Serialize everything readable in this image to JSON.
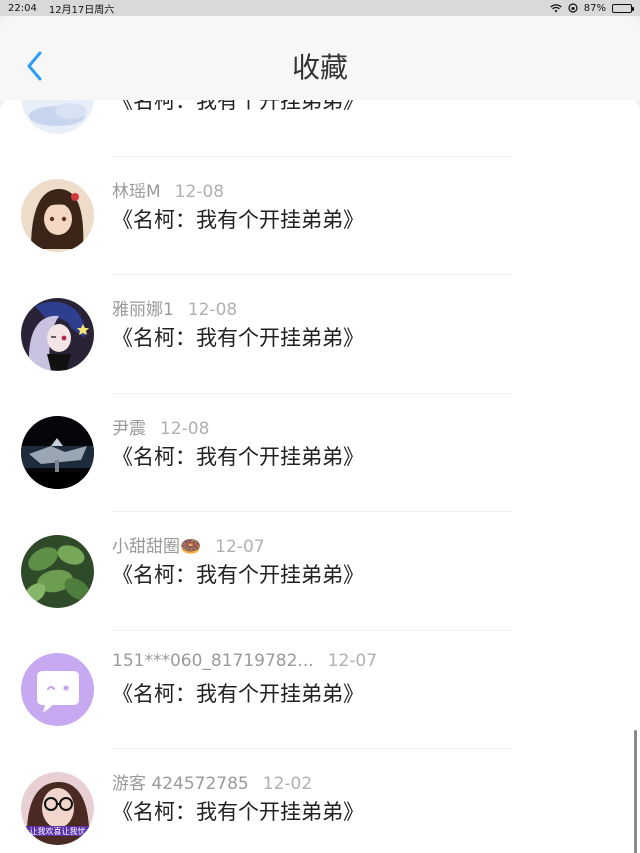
{
  "status": {
    "time": "22:04",
    "date": "12月17日周六",
    "battery": "87%",
    "battery_level": 0.87
  },
  "nav": {
    "title": "收藏"
  },
  "items": [
    {
      "name": "",
      "date": "",
      "title": "《名柯：我有个开挂弟弟》",
      "avatar": "cloud-avatar"
    },
    {
      "name": "林瑶M",
      "date": "12-08",
      "title": "《名柯：我有个开挂弟弟》",
      "avatar": "anime-girl-avatar"
    },
    {
      "name": "雅丽娜1",
      "date": "12-08",
      "title": "《名柯：我有个开挂弟弟》",
      "avatar": "purple-hair-avatar"
    },
    {
      "name": "尹震",
      "date": "12-08",
      "title": "《名柯：我有个开挂弟弟》",
      "avatar": "mecha-avatar"
    },
    {
      "name": "小甜甜圈🍩",
      "date": "12-07",
      "title": "《名柯：我有个开挂弟弟》",
      "avatar": "plant-avatar"
    },
    {
      "name": "151***060_81719782...",
      "date": "12-07",
      "title": "《名柯：我有个开挂弟弟》",
      "avatar": "chat-bubble-avatar"
    },
    {
      "name": "游客 424572785",
      "date": "12-02",
      "title": "《名柯：我有个开挂弟弟》",
      "avatar": "glasses-girl-avatar",
      "avatar_text": "让我欢喜让我忧"
    }
  ]
}
